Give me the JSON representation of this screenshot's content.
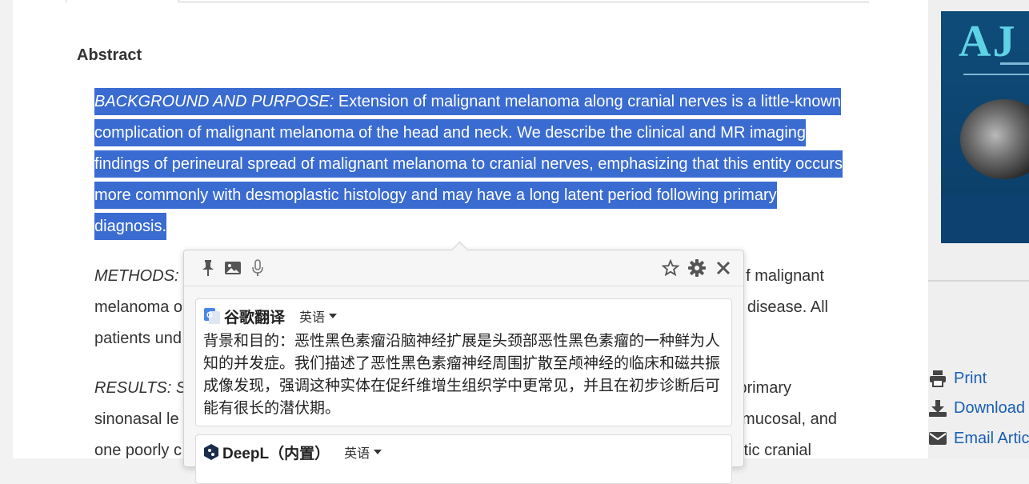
{
  "abstract": {
    "heading": "Abstract",
    "p1_label": "BACKGROUND AND PURPOSE:",
    "p1_text": " Extension of malignant melanoma along cranial nerves is a little-known complication of malignant melanoma of the head and neck. We describe the clinical and MR imaging findings of perineural spread of malignant melanoma to cranial nerves, emphasizing that this entity occurs more commonly with desmoplastic histology and may have a long latent period following primary diagnosis.",
    "p2_label": "METHODS:",
    "p2_line1_end": "f malignant",
    "p2_line2_start": "melanoma o",
    "p2_line2_end": "disease. All",
    "p2_line3_start": "patients und",
    "p3_label": "RESULTS: S",
    "p3_line1_end": "a primary",
    "p3_line2_start": "sinonasal le",
    "p3_line2_end": "mucosal, and",
    "p3_line3_start": "one poorly c",
    "p3_line3_end": "tic cranial"
  },
  "sidebar": {
    "cover_logo": "AJ",
    "tools": {
      "print": "Print",
      "download": "Download",
      "email": "Email Artic"
    }
  },
  "translator": {
    "toolbar_icons": [
      "pin-icon",
      "image-icon",
      "mic-icon",
      "star-icon",
      "gear-icon",
      "close-icon"
    ],
    "google": {
      "name": "谷歌翻译",
      "lang": "英语",
      "translation": "背景和目的：恶性黑色素瘤沿脑神经扩展是头颈部恶性黑色素瘤的一种鲜为人知的并发症。我们描述了恶性黑色素瘤神经周围扩散至颅神经的临床和磁共振成像发现，强调这种实体在促纤维增生组织学中更常见，并且在初步诊断后可能有很长的潜伏期。"
    },
    "deepl": {
      "name": "DeepL（内置）",
      "lang": "英语"
    }
  },
  "colors": {
    "selection": "#3a6bd1",
    "link": "#1a5fb4"
  }
}
